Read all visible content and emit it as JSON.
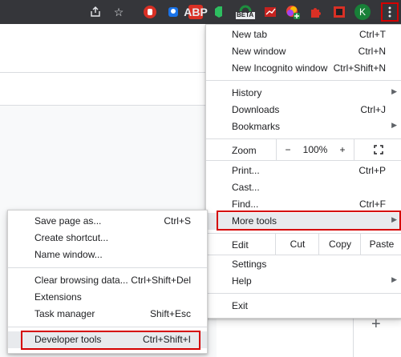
{
  "toolbar": {
    "icons": [
      "share-icon",
      "star-icon",
      "ext-red-hand",
      "ext-blue",
      "ext-abp",
      "ext-evernote",
      "ext-beta",
      "ext-chart",
      "ext-colorful",
      "ext-puzzle",
      "ext-red-square",
      "avatar",
      "kebab-menu"
    ],
    "abp_label": "ABP",
    "beta_label": "BETA",
    "avatar_letter": "K",
    "avatar_color": "#188038"
  },
  "main_menu": {
    "new_tab": {
      "label": "New tab",
      "shortcut": "Ctrl+T"
    },
    "new_window": {
      "label": "New window",
      "shortcut": "Ctrl+N"
    },
    "new_incognito": {
      "label": "New Incognito window",
      "shortcut": "Ctrl+Shift+N"
    },
    "history": {
      "label": "History"
    },
    "downloads": {
      "label": "Downloads",
      "shortcut": "Ctrl+J"
    },
    "bookmarks": {
      "label": "Bookmarks"
    },
    "zoom": {
      "label": "Zoom",
      "minus": "−",
      "value": "100%",
      "plus": "+"
    },
    "print": {
      "label": "Print...",
      "shortcut": "Ctrl+P"
    },
    "cast": {
      "label": "Cast..."
    },
    "find": {
      "label": "Find...",
      "shortcut": "Ctrl+F"
    },
    "more_tools": {
      "label": "More tools"
    },
    "edit": {
      "label": "Edit",
      "cut": "Cut",
      "copy": "Copy",
      "paste": "Paste"
    },
    "settings": {
      "label": "Settings"
    },
    "help": {
      "label": "Help"
    },
    "exit": {
      "label": "Exit"
    }
  },
  "submenu": {
    "save_page": {
      "label": "Save page as...",
      "shortcut": "Ctrl+S"
    },
    "create_shortcut": {
      "label": "Create shortcut..."
    },
    "name_window": {
      "label": "Name window..."
    },
    "clear_browsing": {
      "label": "Clear browsing data...",
      "shortcut": "Ctrl+Shift+Del"
    },
    "extensions": {
      "label": "Extensions"
    },
    "task_manager": {
      "label": "Task manager",
      "shortcut": "Shift+Esc"
    },
    "developer_tools": {
      "label": "Developer tools",
      "shortcut": "Ctrl+Shift+I"
    }
  },
  "highlight_color": "#d50000"
}
